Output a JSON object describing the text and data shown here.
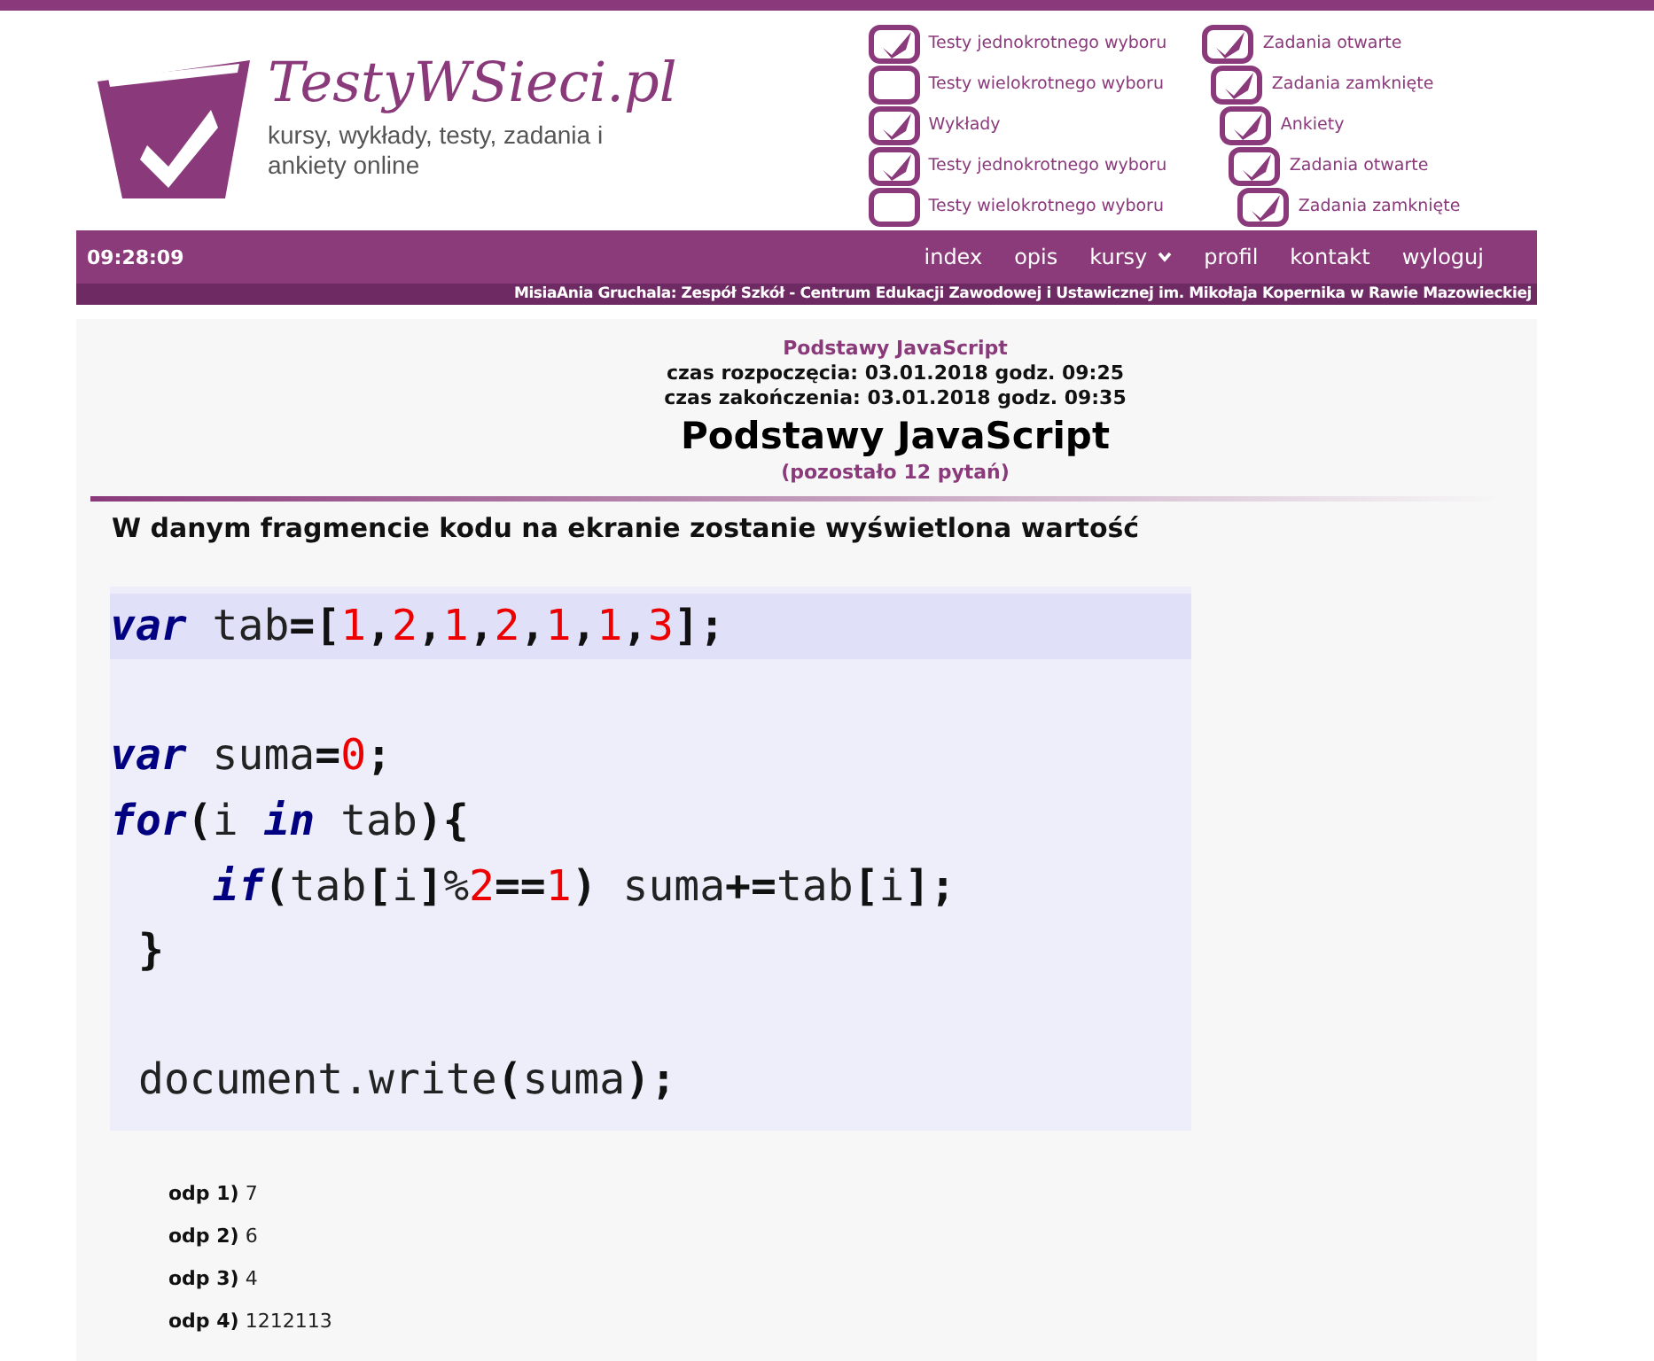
{
  "banner": {
    "logo_text": "TestyWSieci.pl",
    "tagline": "kursy, wykłady, testy, zadania i ankiety online",
    "items": [
      {
        "label": "Testy jednokrotnego wyboru",
        "checked": true
      },
      {
        "label": "Testy wielokrotnego wyboru",
        "checked": false
      },
      {
        "label": "Wykłady",
        "checked": true
      },
      {
        "label": "Testy jednokrotnego wyboru",
        "checked": true
      },
      {
        "label": "Testy wielokrotnego wyboru",
        "checked": false
      }
    ],
    "items_right": [
      {
        "label": "Zadania otwarte",
        "checked": true
      },
      {
        "label": "Zadania zamknięte",
        "checked": true
      },
      {
        "label": "Ankiety",
        "checked": true
      },
      {
        "label": "Zadania otwarte",
        "checked": true
      },
      {
        "label": "Zadania zamknięte",
        "checked": true
      }
    ]
  },
  "nav": {
    "clock": "09:28:09",
    "links": [
      {
        "label": "index",
        "dropdown": false
      },
      {
        "label": "opis",
        "dropdown": false
      },
      {
        "label": "kursy",
        "dropdown": true
      },
      {
        "label": "profil",
        "dropdown": false
      },
      {
        "label": "kontakt",
        "dropdown": false
      },
      {
        "label": "wyloguj",
        "dropdown": false
      }
    ],
    "user_line": "MisiaAnia Gruchala: Zespół Szkół - Centrum Edukacji Zawodowej i Ustawicznej im. Mikołaja Kopernika w Rawie Mazowieckiej"
  },
  "test": {
    "course": "Podstawy JavaScript",
    "start": "czas rozpoczęcia: 03.01.2018 godz. 09:25",
    "end": "czas zakończenia: 03.01.2018 godz. 09:35",
    "title": "Podstawy JavaScript",
    "remaining": "(pozostało 12 pytań)"
  },
  "question": "W danym fragmencie kodu na ekranie zostanie wyświetlona wartość",
  "code": [
    {
      "kind": "code",
      "highlighted": true,
      "tokens": [
        {
          "kind": "keyword",
          "text": "var"
        },
        {
          "kind": "plain",
          "text": " tab"
        },
        {
          "kind": "op",
          "text": "=["
        },
        {
          "kind": "number",
          "text": "1"
        },
        {
          "kind": "op",
          "text": ","
        },
        {
          "kind": "number",
          "text": "2"
        },
        {
          "kind": "op",
          "text": ","
        },
        {
          "kind": "number",
          "text": "1"
        },
        {
          "kind": "op",
          "text": ","
        },
        {
          "kind": "number",
          "text": "2"
        },
        {
          "kind": "op",
          "text": ","
        },
        {
          "kind": "number",
          "text": "1"
        },
        {
          "kind": "op",
          "text": ","
        },
        {
          "kind": "number",
          "text": "1"
        },
        {
          "kind": "op",
          "text": ","
        },
        {
          "kind": "number",
          "text": "3"
        },
        {
          "kind": "op",
          "text": "];"
        }
      ]
    },
    {
      "kind": "blank",
      "highlighted": false
    },
    {
      "kind": "code",
      "highlighted": false,
      "tokens": [
        {
          "kind": "keyword",
          "text": "var"
        },
        {
          "kind": "plain",
          "text": " suma"
        },
        {
          "kind": "op",
          "text": "="
        },
        {
          "kind": "number",
          "text": "0"
        },
        {
          "kind": "op",
          "text": ";"
        }
      ]
    },
    {
      "kind": "code",
      "highlighted": false,
      "tokens": [
        {
          "kind": "keyword",
          "text": "for"
        },
        {
          "kind": "op",
          "text": "("
        },
        {
          "kind": "plain",
          "text": "i "
        },
        {
          "kind": "keyword",
          "text": "in"
        },
        {
          "kind": "plain",
          "text": " tab"
        },
        {
          "kind": "op",
          "text": "){"
        }
      ]
    },
    {
      "kind": "nested",
      "highlighted": false,
      "tokens": [
        {
          "kind": "keyword",
          "text": "if"
        },
        {
          "kind": "op",
          "text": "("
        },
        {
          "kind": "plain",
          "text": "tab"
        },
        {
          "kind": "op",
          "text": "["
        },
        {
          "kind": "plain",
          "text": "i"
        },
        {
          "kind": "op",
          "text": "]"
        },
        {
          "kind": "plain",
          "text": "%"
        },
        {
          "kind": "number",
          "text": "2"
        },
        {
          "kind": "op",
          "text": "=="
        },
        {
          "kind": "number",
          "text": "1"
        },
        {
          "kind": "op",
          "text": ")"
        },
        {
          "kind": "plain",
          "text": " suma"
        },
        {
          "kind": "op",
          "text": "+="
        },
        {
          "kind": "plain",
          "text": "tab"
        },
        {
          "kind": "op",
          "text": "["
        },
        {
          "kind": "plain",
          "text": "i"
        },
        {
          "kind": "op",
          "text": "];"
        }
      ]
    },
    {
      "kind": "offset",
      "highlighted": false,
      "tokens": [
        {
          "kind": "op",
          "text": "}"
        }
      ]
    },
    {
      "kind": "blank",
      "highlighted": false
    },
    {
      "kind": "offset",
      "highlighted": false,
      "tokens": [
        {
          "kind": "plain",
          "text": "document.write"
        },
        {
          "kind": "op",
          "text": "("
        },
        {
          "kind": "plain",
          "text": "suma"
        },
        {
          "kind": "op",
          "text": ");"
        }
      ]
    }
  ],
  "answers": [
    {
      "label": "odp 1)",
      "value": "7"
    },
    {
      "label": "odp 2)",
      "value": "6"
    },
    {
      "label": "odp 3)",
      "value": "4"
    },
    {
      "label": "odp 4)",
      "value": "1212113"
    }
  ]
}
